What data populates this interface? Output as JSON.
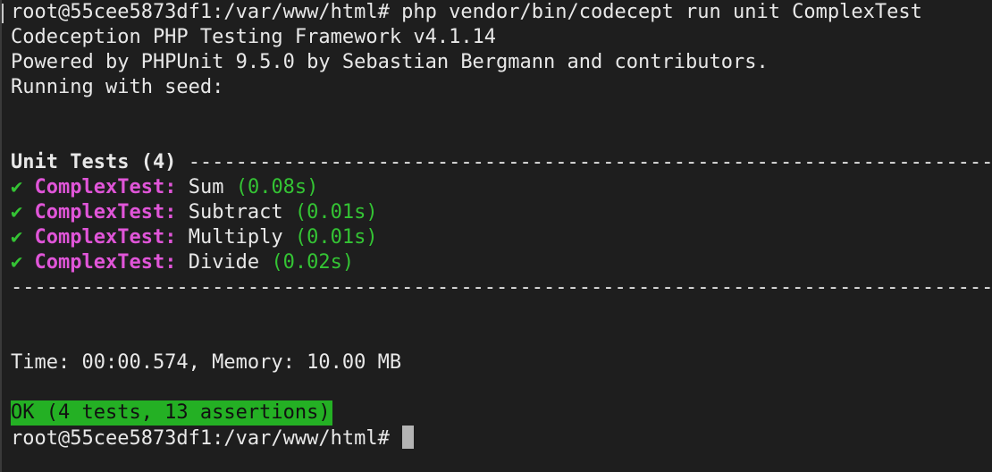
{
  "terminal": {
    "prompt": "root@55cee5873df1:/var/www/html#",
    "command": "php vendor/bin/codecept run unit ComplexTest",
    "lines": {
      "framework": "Codeception PHP Testing Framework v4.1.14",
      "powered": "Powered by PHPUnit 9.5.0 by Sebastian Bergmann and contributors.",
      "seed": "Running with seed:"
    },
    "suite": {
      "title": "Unit Tests (4)",
      "separator": "--------------------------------------------------------------------------------------"
    },
    "tests": [
      {
        "check": "✔",
        "class": "ComplexTest:",
        "name": "Sum",
        "time": "(0.08s)"
      },
      {
        "check": "✔",
        "class": "ComplexTest:",
        "name": "Subtract",
        "time": "(0.01s)"
      },
      {
        "check": "✔",
        "class": "ComplexTest:",
        "name": "Multiply",
        "time": "(0.01s)"
      },
      {
        "check": "✔",
        "class": "ComplexTest:",
        "name": "Divide",
        "time": "(0.02s)"
      }
    ],
    "bottom_separator": "--------------------------------------------------------------------------------------------",
    "summary": "Time: 00:00.574, Memory: 10.00 MB",
    "result": "OK (4 tests, 13 assertions)",
    "final_prompt": "root@55cee5873df1:/var/www/html#"
  },
  "colors": {
    "background": "#1e1e1e",
    "text": "#e8e8e8",
    "class_name": "#e055d8",
    "pass": "#34c434",
    "ok_background": "#24b024"
  }
}
